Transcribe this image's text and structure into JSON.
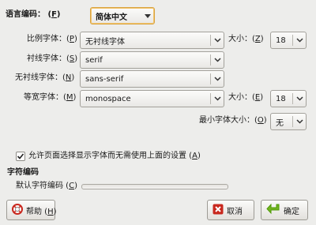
{
  "language": {
    "label": "语言编码：",
    "shortcut": "(F)",
    "shortcut_key": "F",
    "value": "简体中文"
  },
  "fonts": {
    "proportional": {
      "label": "比例字体：",
      "key": "P",
      "value": "无衬线字体"
    },
    "serif": {
      "label": "衬线字体：",
      "key": "S",
      "value": "serif"
    },
    "sans_serif": {
      "label": "无衬线字体：",
      "key": "N",
      "value": "sans-serif"
    },
    "monospace": {
      "label": "等宽字体：",
      "key": "M",
      "value": "monospace"
    },
    "size_label": "大小：",
    "proportional_size": {
      "key": "Z",
      "value": "18"
    },
    "monospace_size": {
      "key": "E",
      "value": "18"
    },
    "min_size": {
      "label": "最小字体大小：",
      "key": "O",
      "value": "无"
    }
  },
  "allow_page_fonts": {
    "label": "允许页面选择显示字体而无需使用上面的设置",
    "key": "A",
    "checked": true
  },
  "encoding": {
    "heading": "字符编码",
    "default_label": "默认字符编码",
    "key": "C",
    "value": ""
  },
  "buttons": {
    "help": {
      "label": "帮助",
      "key": "H"
    },
    "cancel": {
      "label": "取消"
    },
    "ok": {
      "label": "确定"
    }
  },
  "colors": {
    "background": "#ededeb",
    "highlight_border": "#d9a441",
    "cancel_icon": "#c8281e",
    "ok_icon": "#4e9a06"
  }
}
